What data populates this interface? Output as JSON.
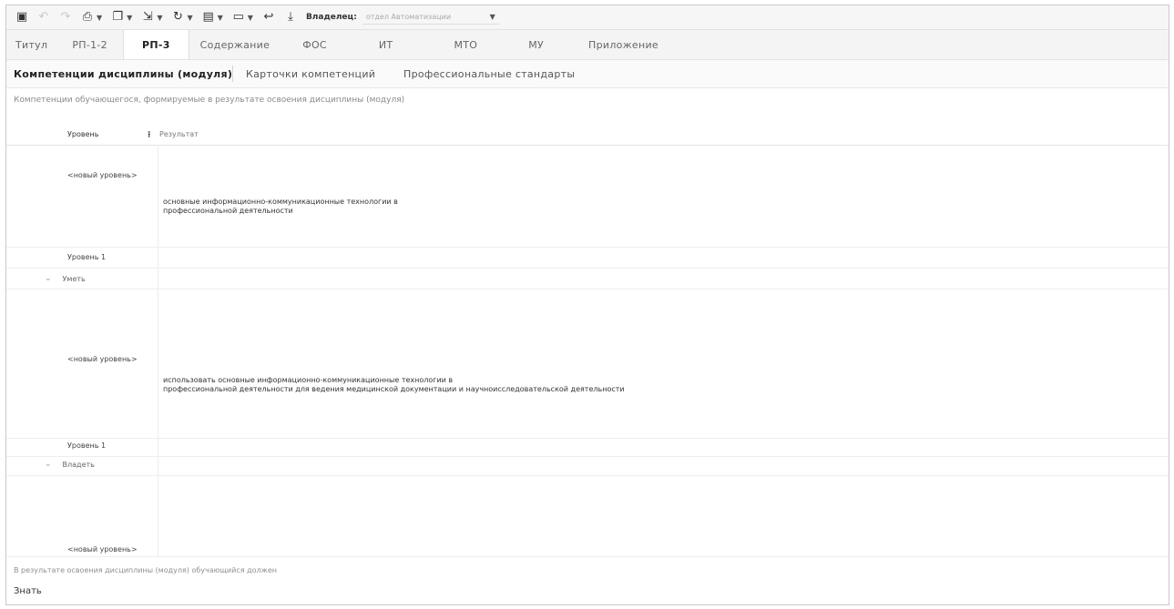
{
  "toolbar": {
    "icons": [
      "save-icon",
      "undo-icon",
      "redo-icon",
      "print-icon",
      "copy-icon",
      "export-icon",
      "refresh-icon",
      "document-icon",
      "tray-icon",
      "back-icon",
      "download-icon"
    ],
    "owner_label": "Владелец:",
    "owner_value": "отдел Автоматизации"
  },
  "tabs": [
    "Титул",
    "РП-1-2",
    "РП-3",
    "Содержание",
    "ФОС",
    "ИТ",
    "МТО",
    "МУ",
    "Приложение"
  ],
  "active_tab": "РП-3",
  "subtabs": [
    "Компетенции дисциплины (модуля)",
    "Карточки компетенций",
    "Профессиональные стандарты"
  ],
  "active_subtab": "Компетенции дисциплины (модуля)",
  "caption": "Компетенции обучающегося, формируемые в результате освоения дисциплины (модуля)",
  "grid": {
    "col_level": "Уровень",
    "col_result": "Результат",
    "rows": [
      {
        "level": "<новый уровень>",
        "result_line1": "основные информационно-коммуникационные технологии в",
        "result_line2": "профессиональной деятельности"
      },
      {
        "level": "Уровень 1"
      },
      {
        "group": "Уметь"
      },
      {
        "level": "<новый уровень>",
        "result_line1": "использовать основные информационно-коммуникационные технологии в",
        "result_line2": "профессиональной деятельности для ведения медицинской документации и научноисследовательской деятельности"
      },
      {
        "level": "Уровень 1"
      },
      {
        "group": "Владеть"
      },
      {
        "level": "<новый уровень>"
      }
    ]
  },
  "footer_note": "В результате освоения дисциплины (модуля) обучающийся должен",
  "footer_know": "Знать"
}
